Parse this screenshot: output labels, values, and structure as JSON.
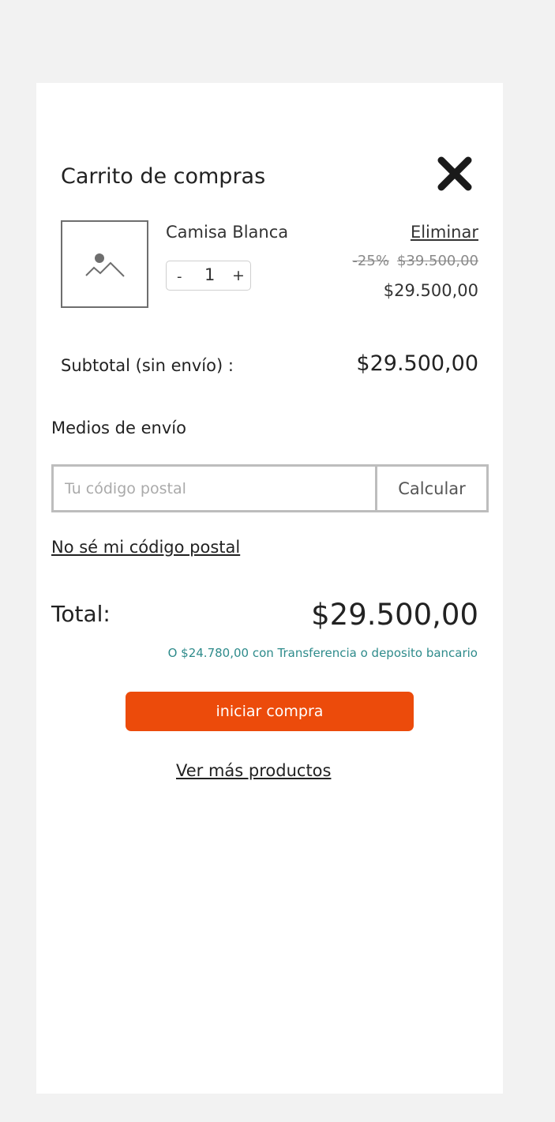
{
  "cart": {
    "title": "Carrito de compras",
    "close_icon": "close-icon",
    "remove_label": "Eliminar"
  },
  "item": {
    "image_icon": "image-placeholder-icon",
    "name": "Camisa Blanca",
    "qty_minus": "-",
    "qty": "1",
    "qty_plus": "+",
    "discount": "-25%",
    "original_price": "$39.500,00",
    "price": "$29.500,00"
  },
  "subtotal": {
    "label": "Subtotal (sin envío) :",
    "value": "$29.500,00"
  },
  "shipping": {
    "title": "Medios de envío",
    "postal_placeholder": "Tu código postal",
    "postal_value": "",
    "calculate_label": "Calcular",
    "unknown_postal_link": "No sé mi código postal"
  },
  "total": {
    "label": "Total:",
    "value": "$29.500,00",
    "transfer_note": "O $24.780,00 con Transferencia o deposito bancario"
  },
  "actions": {
    "checkout_label": "iniciar compra",
    "more_products_label": "Ver más productos"
  },
  "colors": {
    "accent": "#ec4b0b",
    "transfer_text": "#2e8b8b",
    "background": "#f2f2f2"
  }
}
